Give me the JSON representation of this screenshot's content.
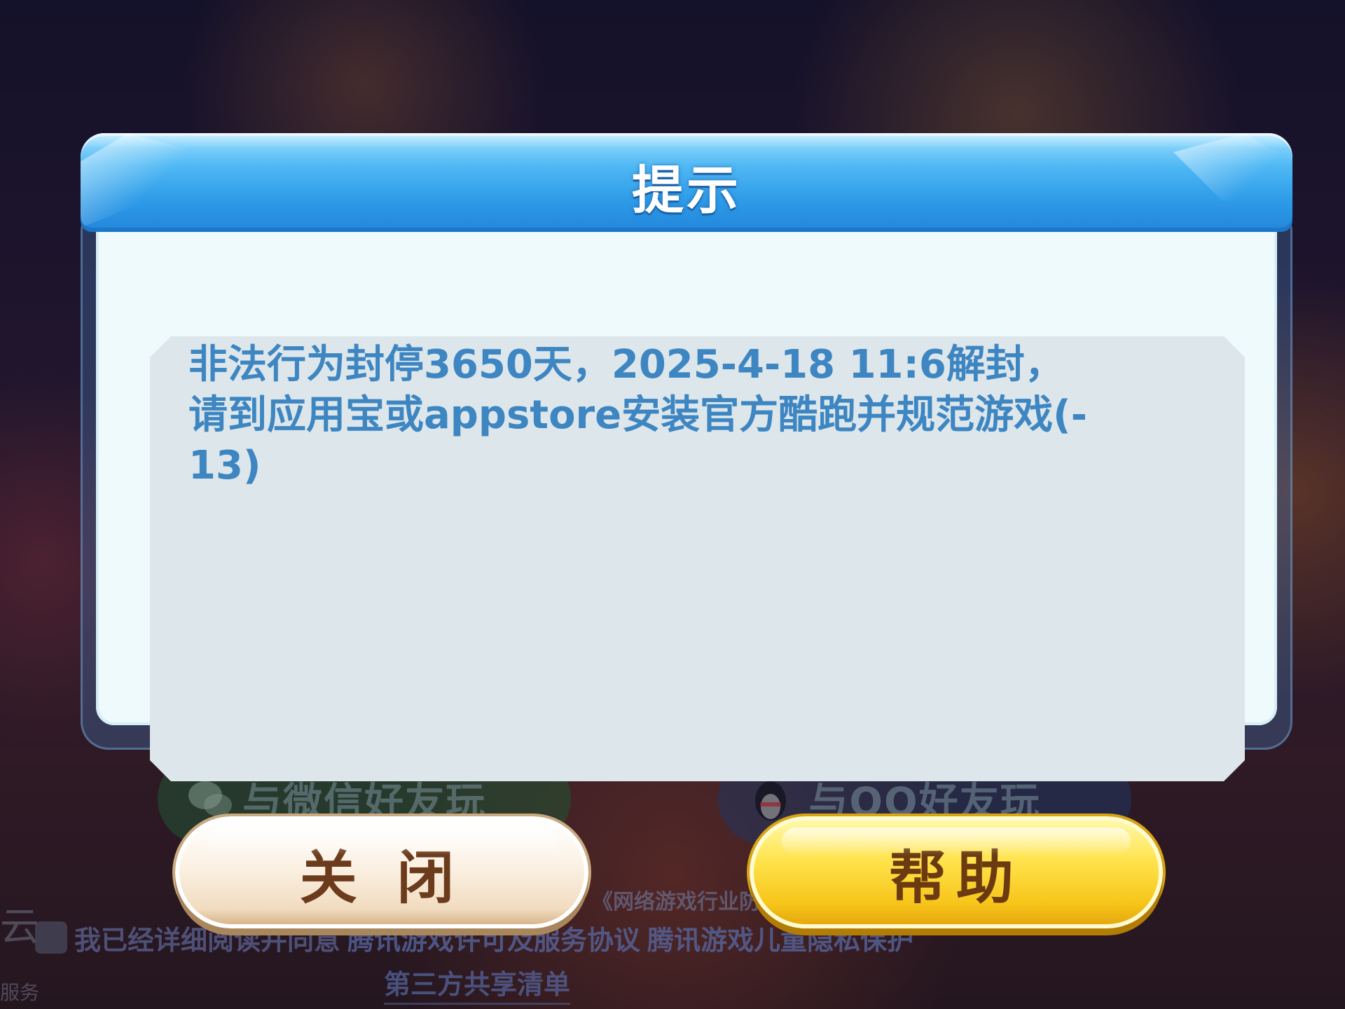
{
  "background": {
    "wechat_button_label": "与微信好友玩",
    "qq_button_label": "与QQ好友玩",
    "agreement_prefix": "我已经详细阅读并同意",
    "agreement_link_1": "腾讯游戏许可及服务协议",
    "agreement_link_2": "腾讯游戏儿童隐私保护",
    "agreement_link_3": "第三方共享清单",
    "industry_notice": "《网络游戏行业防",
    "side_text_1": "云",
    "side_text_2": "服务"
  },
  "dialog": {
    "title": "提示",
    "message": "非法行为封停3650天，2025-4-18 11:6解封，请到应用宝或appstore安装官方酷跑并规范游戏(-13)"
  },
  "buttons": {
    "close_label": "关 闭",
    "help_label": "帮助"
  },
  "colors": {
    "header_blue": "#2e9ce8",
    "message_text": "#3d86c2",
    "close_button": "#f1dcc0",
    "help_button": "#ffe24a"
  }
}
